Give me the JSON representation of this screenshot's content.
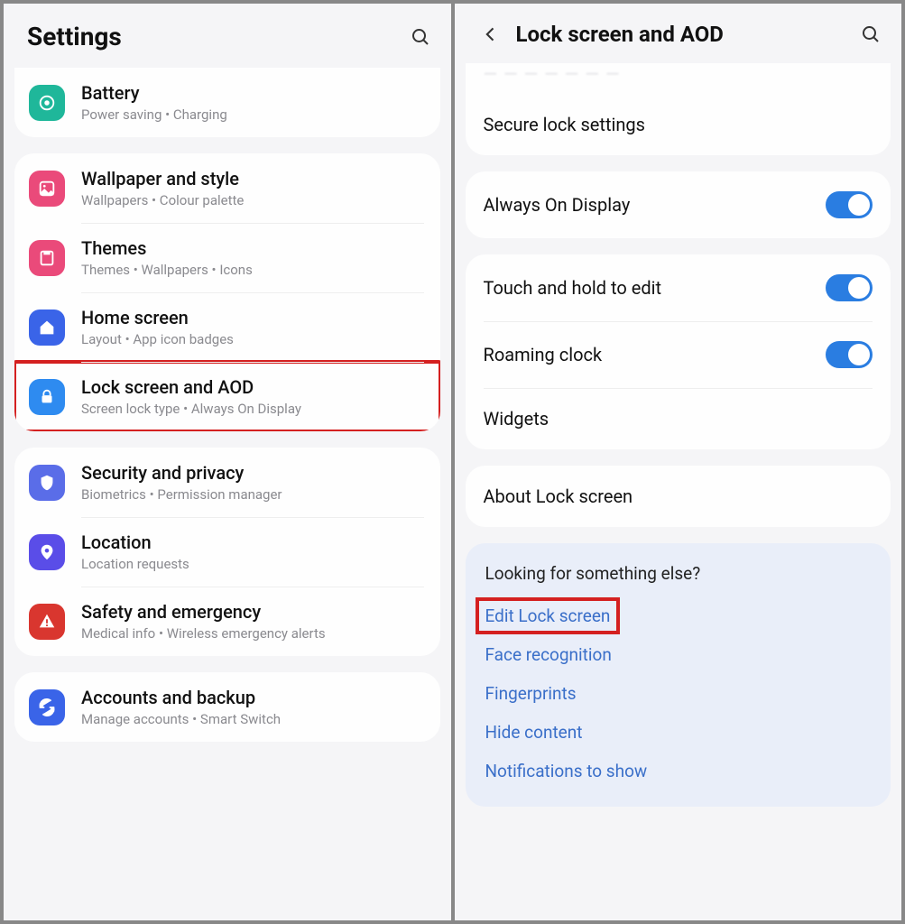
{
  "left": {
    "title": "Settings",
    "groups": [
      {
        "items": [
          {
            "key": "battery",
            "title": "Battery",
            "sub": "Power saving  •  Charging",
            "icon": "battery-icon",
            "color": "ic-teal"
          }
        ],
        "partialTop": true
      },
      {
        "items": [
          {
            "key": "wallpaper",
            "title": "Wallpaper and style",
            "sub": "Wallpapers  •  Colour palette",
            "icon": "wallpaper-icon",
            "color": "ic-pink"
          },
          {
            "key": "themes",
            "title": "Themes",
            "sub": "Themes  •  Wallpapers  •  Icons",
            "icon": "themes-icon",
            "color": "ic-pink2"
          },
          {
            "key": "home",
            "title": "Home screen",
            "sub": "Layout  •  App icon badges",
            "icon": "home-icon",
            "color": "ic-blue"
          },
          {
            "key": "lockscreen",
            "title": "Lock screen and AOD",
            "sub": "Screen lock type  •  Always On Display",
            "icon": "lock-icon",
            "color": "ic-blue2",
            "highlight": true
          }
        ]
      },
      {
        "items": [
          {
            "key": "security",
            "title": "Security and privacy",
            "sub": "Biometrics  •  Permission manager",
            "icon": "shield-icon",
            "color": "ic-indigo"
          },
          {
            "key": "location",
            "title": "Location",
            "sub": "Location requests",
            "icon": "location-icon",
            "color": "ic-violet"
          },
          {
            "key": "safety",
            "title": "Safety and emergency",
            "sub": "Medical info  •  Wireless emergency alerts",
            "icon": "alert-icon",
            "color": "ic-red"
          }
        ]
      },
      {
        "items": [
          {
            "key": "accounts",
            "title": "Accounts and backup",
            "sub": "Manage accounts  •  Smart Switch",
            "icon": "sync-icon",
            "color": "ic-blue"
          }
        ]
      }
    ]
  },
  "right": {
    "title": "Lock screen and AOD",
    "topCutoff": "— — — — — — —",
    "groups": [
      {
        "items": [
          {
            "key": "securelock",
            "title": "Secure lock settings"
          }
        ],
        "partialTop": true
      },
      {
        "items": [
          {
            "key": "aod",
            "title": "Always On Display",
            "toggle": true
          }
        ]
      },
      {
        "items": [
          {
            "key": "touchhold",
            "title": "Touch and hold to edit",
            "toggle": true
          },
          {
            "key": "roaming",
            "title": "Roaming clock",
            "toggle": true
          },
          {
            "key": "widgets",
            "title": "Widgets"
          }
        ]
      },
      {
        "items": [
          {
            "key": "about",
            "title": "About Lock screen"
          }
        ]
      }
    ],
    "suggest": {
      "heading": "Looking for something else?",
      "links": [
        {
          "key": "editlock",
          "label": "Edit Lock screen",
          "highlight": true
        },
        {
          "key": "face",
          "label": "Face recognition"
        },
        {
          "key": "finger",
          "label": "Fingerprints"
        },
        {
          "key": "hide",
          "label": "Hide content"
        },
        {
          "key": "notif",
          "label": "Notifications to show"
        }
      ]
    }
  }
}
